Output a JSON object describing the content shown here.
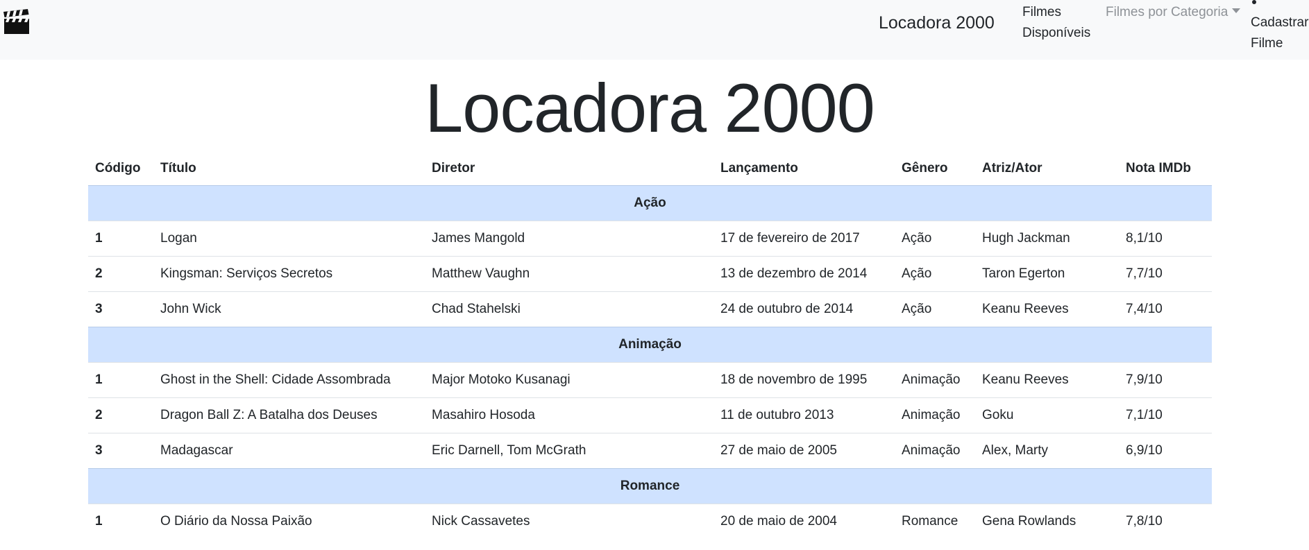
{
  "navbar": {
    "brand": "Locadora 2000",
    "links": {
      "filmes_disponiveis": "Filmes Disponíveis",
      "filmes_por_categoria": "Filmes por Categoria",
      "cadastrar_filme": "Cadastrar Filme"
    },
    "icon": "clapperboard-icon"
  },
  "page_title": "Locadora 2000",
  "table": {
    "headers": [
      "Código",
      "Título",
      "Diretor",
      "Lançamento",
      "Gênero",
      "Atriz/Ator",
      "Nota IMDb"
    ],
    "groups": [
      {
        "name": "Ação",
        "rows": [
          [
            "1",
            "Logan",
            "James Mangold",
            "17 de fevereiro de 2017",
            "Ação",
            "Hugh Jackman",
            "8,1/10"
          ],
          [
            "2",
            "Kingsman: Serviços Secretos",
            "Matthew Vaughn",
            "13 de dezembro de 2014",
            "Ação",
            "Taron Egerton",
            "7,7/10"
          ],
          [
            "3",
            "John Wick",
            "Chad Stahelski",
            "24 de outubro de 2014",
            "Ação",
            "Keanu Reeves",
            "7,4/10"
          ]
        ]
      },
      {
        "name": "Animação",
        "rows": [
          [
            "1",
            "Ghost in the Shell: Cidade Assombrada",
            "Major Motoko Kusanagi",
            "18 de novembro de 1995",
            "Animação",
            "Keanu Reeves",
            "7,9/10"
          ],
          [
            "2",
            "Dragon Ball Z: A Batalha dos Deuses",
            "Masahiro Hosoda",
            "11 de outubro 2013",
            "Animação",
            "Goku",
            "7,1/10"
          ],
          [
            "3",
            "Madagascar",
            "Eric Darnell, Tom McGrath",
            "27 de maio de 2005",
            "Animação",
            "Alex, Marty",
            "6,9/10"
          ]
        ]
      },
      {
        "name": "Romance",
        "rows": [
          [
            "1",
            "O Diário da Nossa Paixão",
            "Nick Cassavetes",
            "20 de maio de 2004",
            "Romance",
            "Gena Rowlands",
            "7,8/10"
          ]
        ]
      }
    ]
  },
  "colors": {
    "navbar_bg": "#f8f9fa",
    "group_row_bg": "#cfe2ff",
    "muted_link": "#8e9297"
  }
}
